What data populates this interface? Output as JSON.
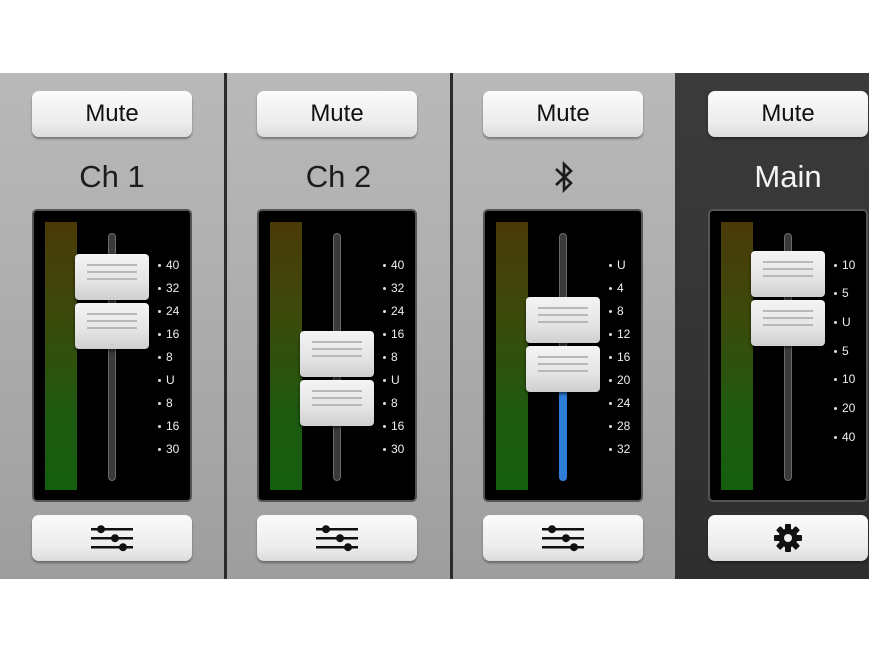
{
  "channels": [
    {
      "name": "Ch 1",
      "mute_label": "Mute",
      "bottom_icon": "sliders-icon",
      "fader_level": 0.14,
      "scale_ticks": [
        "40",
        "32",
        "24",
        "16",
        "8",
        "U",
        "8",
        "16",
        "30"
      ]
    },
    {
      "name": "Ch 2",
      "mute_label": "Mute",
      "bottom_icon": "sliders-icon",
      "fader_level": 0.48,
      "scale_ticks": [
        "40",
        "32",
        "24",
        "16",
        "8",
        "U",
        "8",
        "16",
        "30"
      ]
    },
    {
      "name": "",
      "name_icon": "bluetooth-icon",
      "mute_label": "Mute",
      "bottom_icon": "sliders-icon",
      "fader_level": 0.32,
      "fill_color": "#2d7fd8",
      "scale_ticks": [
        "U",
        "4",
        "8",
        "12",
        "16",
        "20",
        "24",
        "28",
        "32"
      ]
    },
    {
      "name": "Main",
      "mute_label": "Mute",
      "bottom_icon": "gear-icon",
      "fader_level": 0.12,
      "scale_ticks": [
        "10",
        "5",
        "U",
        "5",
        "10",
        "20",
        "40"
      ]
    }
  ],
  "colors": {
    "strip_light": "#adadad",
    "strip_dark": "#333333",
    "panel": "#000000",
    "meter_bottom": "#155f0f",
    "meter_top": "#4a3a08",
    "blue_fill": "#2d7fd8"
  }
}
